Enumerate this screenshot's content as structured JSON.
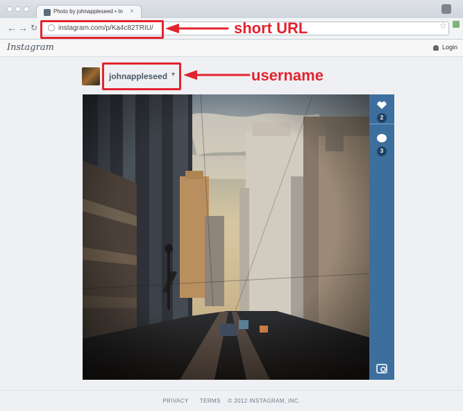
{
  "browser": {
    "tab_title": "Photo by johnappleseed • In",
    "url": "instagram.com/p/Ka4c82TRIU/"
  },
  "site": {
    "logo": "Instagram",
    "login_label": "Login"
  },
  "profile": {
    "username": "johnappleseed",
    "caret": "▾"
  },
  "photo": {
    "description_present": true,
    "likes_count": "2",
    "comments_count": "3"
  },
  "footer": {
    "privacy": "PRIVACY",
    "terms": "TERMS",
    "copyright": "© 2012 INSTAGRAM, INC."
  },
  "annotations": {
    "url_label": "short URL",
    "username_label": "username",
    "color": "#e3232f"
  },
  "icons": {
    "heart": "heart-icon",
    "comment": "comment-icon",
    "camera": "camera-icon",
    "person": "person-icon"
  }
}
